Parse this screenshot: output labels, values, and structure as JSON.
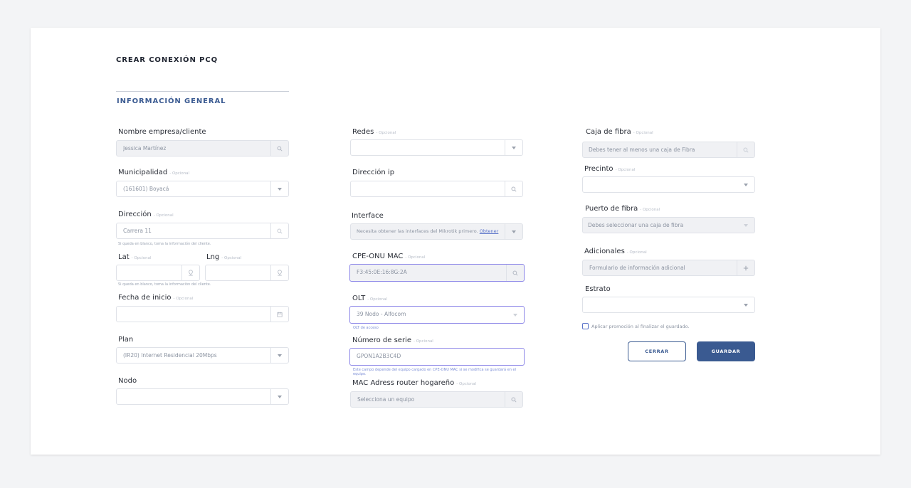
{
  "page": {
    "title": "CREAR CONEXIÓN PCQ",
    "section_title": "INFORMACIÓN GENERAL",
    "optional_tag": "- Opcional"
  },
  "col1": {
    "nombre": {
      "label": "Nombre empresa/cliente",
      "value": "Jessica Martínez"
    },
    "municipalidad": {
      "label": "Municipalidad",
      "value": "(161601) Boyacá"
    },
    "direccion": {
      "label": "Dirección",
      "value": "Carrera 11",
      "hint": "Si queda en blanco, toma la información del cliente."
    },
    "lat": {
      "label": "Lat",
      "value": ""
    },
    "lng": {
      "label": "Lng",
      "value": ""
    },
    "latlng_hint": "Si queda en blanco, toma la información del cliente.",
    "fecha_inicio": {
      "label": "Fecha de inicio",
      "value": ""
    },
    "plan": {
      "label": "Plan",
      "value": "(IR20) Internet Residencial 20Mbps"
    },
    "nodo": {
      "label": "Nodo",
      "value": ""
    }
  },
  "col2": {
    "redes": {
      "label": "Redes",
      "value": ""
    },
    "direccion_ip": {
      "label": "Dirección ip",
      "value": ""
    },
    "interface": {
      "label": "Interface",
      "text": "Necesita obtener las interfaces del Mikrotik primero.",
      "link": "Obtener"
    },
    "cpe_onu_mac": {
      "label": "CPE-ONU MAC",
      "value": "F3:45:0E:16:8G:2A"
    },
    "olt": {
      "label": "OLT",
      "value": "39 Nodo - Alfocom",
      "hint": "OLT de acceso"
    },
    "numero_serie": {
      "label": "Número de serie",
      "value": "GPON1A2B3C4D",
      "hint": "Este campo depende del equipo cargado en CPE-ONU MAC si se modifica se guardará en el equipo."
    },
    "mac_router": {
      "label": "MAC Adress router hogareño",
      "placeholder": "Selecciona un equipo"
    }
  },
  "col3": {
    "caja_fibra": {
      "label": "Caja de fibra",
      "placeholder": "Debes tener al menos una caja de Fibra"
    },
    "precinto": {
      "label": "Precinto",
      "value": ""
    },
    "puerto_fibra": {
      "label": "Puerto de fibra",
      "placeholder": "Debes seleccionar una caja de fibra"
    },
    "adicionales": {
      "label": "Adicionales",
      "placeholder": "Formulario de información adicional"
    },
    "estrato": {
      "label": "Estrato",
      "value": ""
    },
    "promo_checkbox": {
      "label": "Aplicar promoción al finalizar el guardado.",
      "checked": false
    }
  },
  "actions": {
    "cancel_label": "CERRAR",
    "save_label": "GUARDAR"
  },
  "colors": {
    "accent": "#3a5a91",
    "focus_border": "#8d87e8",
    "link": "#5a73c9"
  },
  "icons": {
    "search": "search-icon",
    "dropdown": "chevron-down-icon",
    "location": "location-pin-icon",
    "calendar": "calendar-icon",
    "plus": "plus-icon"
  }
}
